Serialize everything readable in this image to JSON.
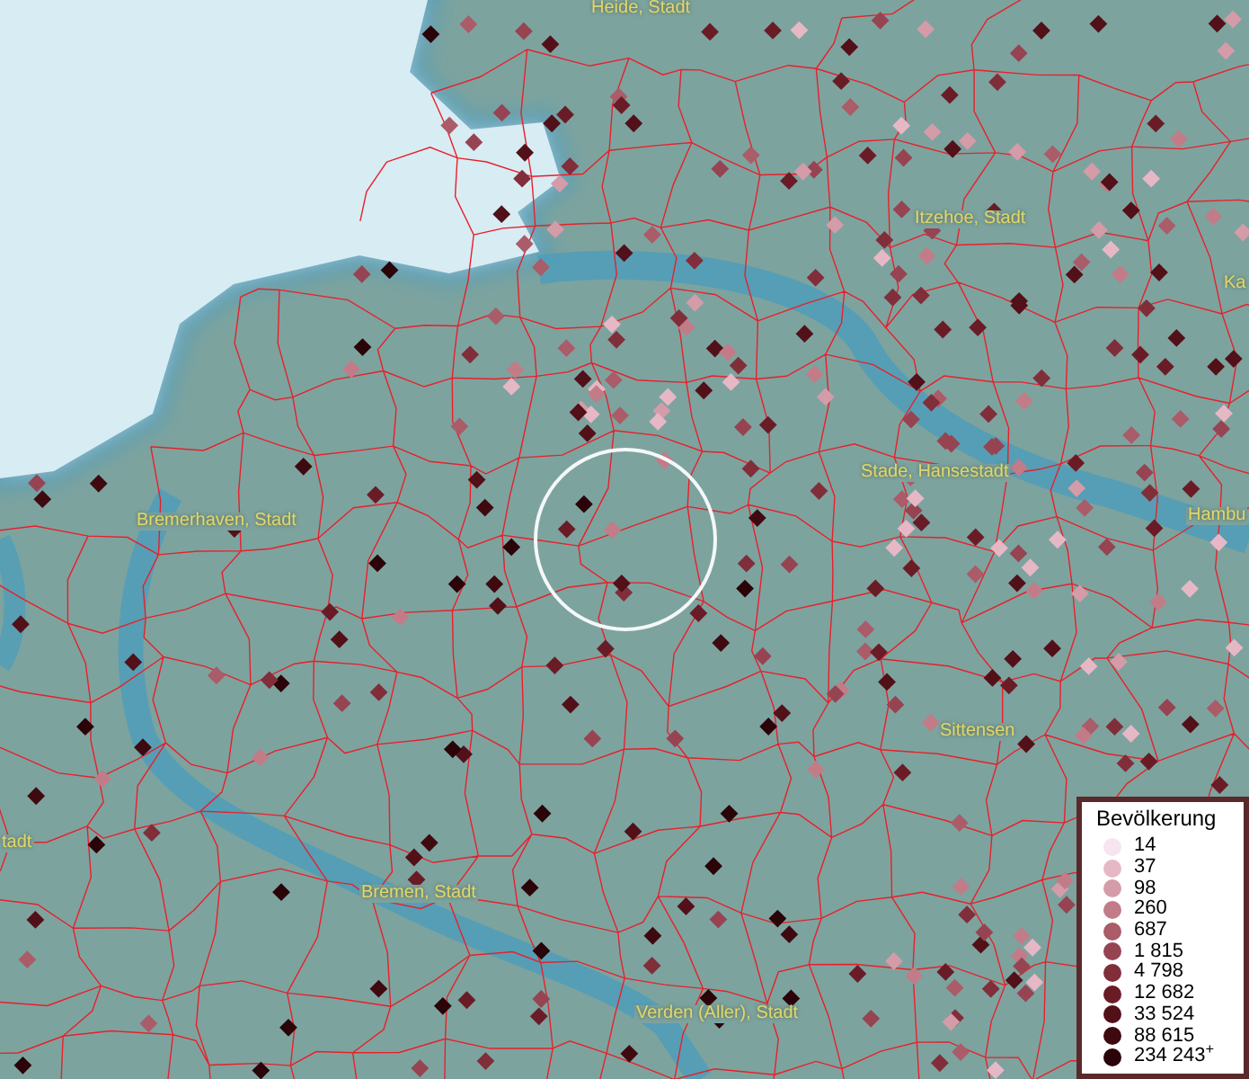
{
  "map": {
    "labels": [
      {
        "text": "Heide, Stadt"
      },
      {
        "text": "Itzehoe, Stadt"
      },
      {
        "text": "Ka"
      },
      {
        "text": "Stade, Hansestadt"
      },
      {
        "text": "Hambu"
      },
      {
        "text": "Bremerhaven, Stadt"
      },
      {
        "text": "Sittensen"
      },
      {
        "text": "tadt"
      },
      {
        "text": "Bremen, Stadt"
      },
      {
        "text": "Verden (Aller), Stadt"
      }
    ]
  },
  "legend": {
    "title": "Bevölkerung",
    "items": [
      {
        "label": "14",
        "color": "#f8e4ee"
      },
      {
        "label": "37",
        "color": "#e6b8c6"
      },
      {
        "label": "98",
        "color": "#d49ca8"
      },
      {
        "label": "260",
        "color": "#c27c88"
      },
      {
        "label": "687",
        "color": "#aa5c68"
      },
      {
        "label": "1 815",
        "color": "#964452"
      },
      {
        "label": "4 798",
        "color": "#802e3a"
      },
      {
        "label": "12 682",
        "color": "#6a1c26"
      },
      {
        "label": "33 524",
        "color": "#521019"
      },
      {
        "label": "88 615",
        "color": "#3e0a10"
      },
      {
        "label": "234 243$^{+}$",
        "color": "#2a0408"
      }
    ]
  }
}
